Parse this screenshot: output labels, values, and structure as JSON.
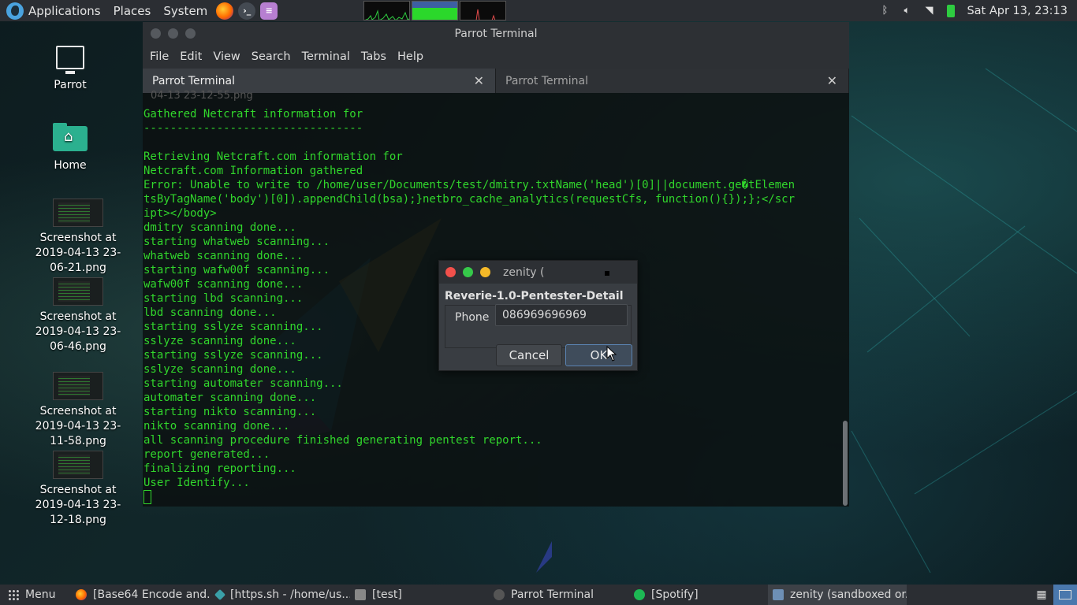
{
  "top_panel": {
    "applications": "Applications",
    "places": "Places",
    "system": "System",
    "clock": "Sat Apr 13, 23:13"
  },
  "desktop": {
    "icons": [
      {
        "label": "Parrot"
      },
      {
        "label": "Home"
      },
      {
        "label": "Screenshot at 2019-04-13 23-06-21.png"
      },
      {
        "label": "Screenshot at 2019-04-13 23-06-46.png"
      },
      {
        "label": "Screenshot at 2019-04-13 23-11-58.png"
      },
      {
        "label": "Screenshot at 2019-04-13 23-12-18.png"
      }
    ]
  },
  "terminal": {
    "title": "Parrot Terminal",
    "menu": [
      "File",
      "Edit",
      "View",
      "Search",
      "Terminal",
      "Tabs",
      "Help"
    ],
    "tabs": [
      {
        "label": "Parrot Terminal",
        "close": "✕"
      },
      {
        "label": "Parrot Terminal",
        "close": "✕"
      }
    ],
    "faded": "04-13 23-12-55.png",
    "lines": [
      "Gathered Netcraft information for ",
      "---------------------------------",
      "",
      "Retrieving Netcraft.com information for ",
      "Netcraft.com Information gathered",
      "Error: Unable to write to /home/user/Documents/test/dmitry.txtName('head')[0]||document.ge�tElemen",
      "tsByTagName('body')[0]).appendChild(bsa);}netbro_cache_analytics(requestCfs, function(){});};</scr",
      "ipt></body>",
      "dmitry scanning done...",
      "starting whatweb scanning...",
      "whatweb scanning done...",
      "starting wafw00f scanning...",
      "wafw00f scanning done...",
      "starting lbd scanning...",
      "lbd scanning done...",
      "starting sslyze scanning...",
      "sslyze scanning done...",
      "starting sslyze scanning...",
      "sslyze scanning done...",
      "starting automater scanning...",
      "automater scanning done...",
      "starting nikto scanning...",
      "nikto scanning done...",
      "all scanning procedure finished generating pentest report...",
      "report generated...",
      "finalizing reporting...",
      "User Identify..."
    ]
  },
  "dialog": {
    "title": "zenity (",
    "heading": "Reverie-1.0-Pentester-Detail",
    "field_label": "Phone",
    "field_value": "086969696969",
    "cancel": "Cancel",
    "ok": "OK"
  },
  "taskbar": {
    "menu": "Menu",
    "tasks": [
      {
        "label": "[Base64 Encode and...",
        "icon": "firefox-icon"
      },
      {
        "label": "[https.sh - /home/us...",
        "icon": "editor-icon"
      },
      {
        "label": "[test]",
        "icon": "folder-icon"
      },
      {
        "label": "Parrot Terminal",
        "icon": "terminal-icon"
      },
      {
        "label": "[Spotify]",
        "icon": "spotify-icon"
      },
      {
        "label": "zenity (sandboxed or...",
        "icon": "zenity-icon"
      }
    ]
  }
}
